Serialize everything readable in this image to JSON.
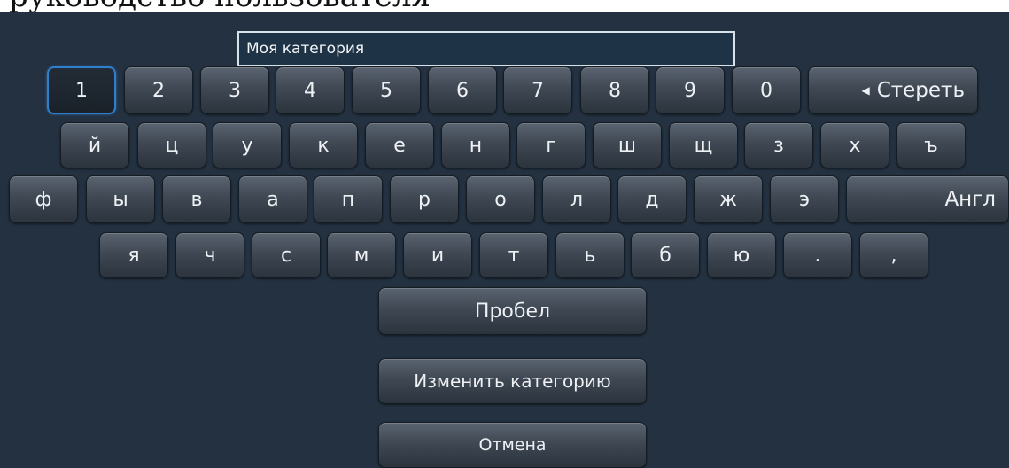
{
  "overlay_text": "руководство пользователя",
  "input": {
    "value": "Моя категория"
  },
  "keyboard": {
    "row1": [
      "1",
      "2",
      "3",
      "4",
      "5",
      "6",
      "7",
      "8",
      "9",
      "0"
    ],
    "backspace_icon": "left-triangle",
    "backspace_label": "Стереть",
    "row2": [
      "й",
      "ц",
      "у",
      "к",
      "е",
      "н",
      "г",
      "ш",
      "щ",
      "з",
      "х",
      "ъ"
    ],
    "row3": [
      "ф",
      "ы",
      "в",
      "а",
      "п",
      "р",
      "о",
      "л",
      "д",
      "ж",
      "э"
    ],
    "lang_label": "Англ",
    "row4": [
      "я",
      "ч",
      "с",
      "м",
      "и",
      "т",
      "ь",
      "б",
      "ю",
      ".",
      ","
    ],
    "space_label": "Пробел"
  },
  "actions": {
    "change_category": "Изменить категорию",
    "cancel": "Отмена"
  },
  "colors": {
    "background": "#233140",
    "key_top": "#5a6470",
    "key_bottom": "#2b333d",
    "focus_border": "#2f7fd0",
    "text": "#eef1f4"
  }
}
